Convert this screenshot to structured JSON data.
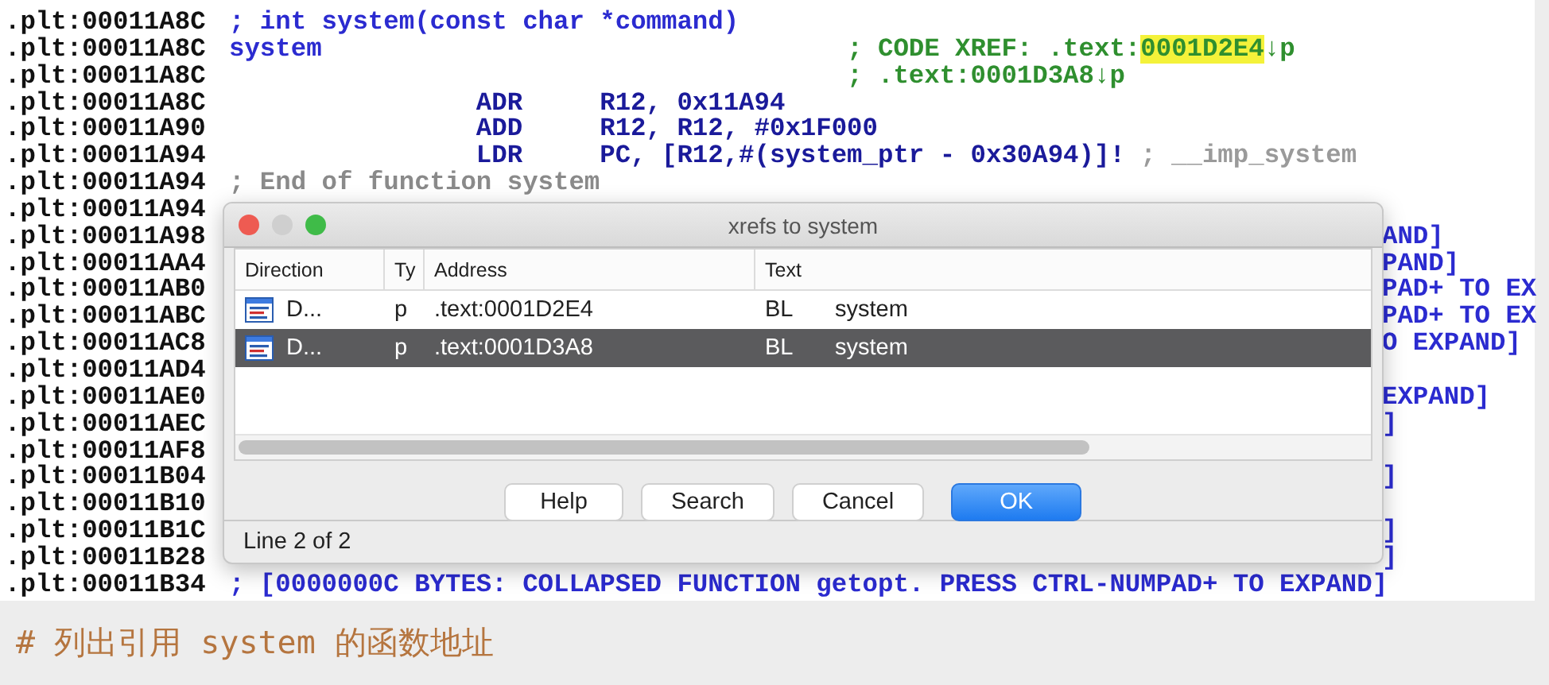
{
  "code_lines": [
    {
      "address": ".plt:00011A8C",
      "kind": "comment",
      "text": "; int system(const char *command)"
    },
    {
      "address": ".plt:00011A8C",
      "kind": "label",
      "text": "system",
      "xref": [
        {
          "text": "; CODE XREF: .text:",
          "highlighted": false
        },
        {
          "text": "0001D2E4",
          "highlighted": true
        },
        {
          "text": "↓p",
          "highlighted": false
        }
      ]
    },
    {
      "address": ".plt:00011A8C",
      "kind": "xref",
      "xref": [
        {
          "text": "; .text:0001D3A8↓p",
          "highlighted": false
        }
      ]
    },
    {
      "address": ".plt:00011A8C",
      "kind": "instruction",
      "mnemonic": "ADR",
      "operands": "R12, 0x11A94"
    },
    {
      "address": ".plt:00011A90",
      "kind": "instruction",
      "mnemonic": "ADD",
      "operands": "R12, R12, #0x1F000"
    },
    {
      "address": ".plt:00011A94",
      "kind": "instruction",
      "mnemonic": "LDR",
      "operands": "PC, [R12,#(system_ptr - 0x30A94)]!",
      "comment": "; __imp_system"
    },
    {
      "address": ".plt:00011A94",
      "kind": "end",
      "text": "; End of function system"
    },
    {
      "address": ".plt:00011A94",
      "kind": "blank"
    },
    {
      "address": ".plt:00011A98",
      "kind": "covered",
      "tail": "AND]"
    },
    {
      "address": ".plt:00011AA4",
      "kind": "covered",
      "tail": "PAND]"
    },
    {
      "address": ".plt:00011AB0",
      "kind": "covered",
      "tail": "PAD+ TO EX"
    },
    {
      "address": ".plt:00011ABC",
      "kind": "covered",
      "tail": "PAD+ TO EX"
    },
    {
      "address": ".plt:00011AC8",
      "kind": "covered",
      "tail": "O EXPAND]"
    },
    {
      "address": ".plt:00011AD4",
      "kind": "covered"
    },
    {
      "address": ".plt:00011AE0",
      "kind": "covered",
      "tail": "EXPAND]"
    },
    {
      "address": ".plt:00011AEC",
      "kind": "covered",
      "tail": "]"
    },
    {
      "address": ".plt:00011AF8",
      "kind": "covered"
    },
    {
      "address": ".plt:00011B04",
      "kind": "covered",
      "tail": "]"
    },
    {
      "address": ".plt:00011B10",
      "kind": "covered"
    },
    {
      "address": ".plt:00011B1C",
      "kind": "covered",
      "tail": "]"
    },
    {
      "address": ".plt:00011B28",
      "kind": "covered",
      "tail": "]"
    },
    {
      "address": ".plt:00011B34",
      "kind": "collapsed",
      "text": "; [0000000C BYTES: COLLAPSED FUNCTION getopt. PRESS CTRL-NUMPAD+ TO EXPAND]"
    }
  ],
  "dialog": {
    "title": "xrefs to system",
    "columns": [
      "Direction",
      "Ty",
      "Address",
      "Text"
    ],
    "rows": [
      {
        "direction": "D...",
        "type": "p",
        "address": ".text:0001D2E4",
        "instruction": "BL",
        "target": "system",
        "selected": false
      },
      {
        "direction": "D...",
        "type": "p",
        "address": ".text:0001D3A8",
        "instruction": "BL",
        "target": "system",
        "selected": true
      }
    ],
    "buttons": [
      {
        "label": "Help",
        "kind": "normal"
      },
      {
        "label": "Search",
        "kind": "normal"
      },
      {
        "label": "Cancel",
        "kind": "normal"
      },
      {
        "label": "OK",
        "kind": "default"
      }
    ],
    "status": "Line 2 of 2"
  },
  "caption": "# 列出引用 system 的函数地址"
}
